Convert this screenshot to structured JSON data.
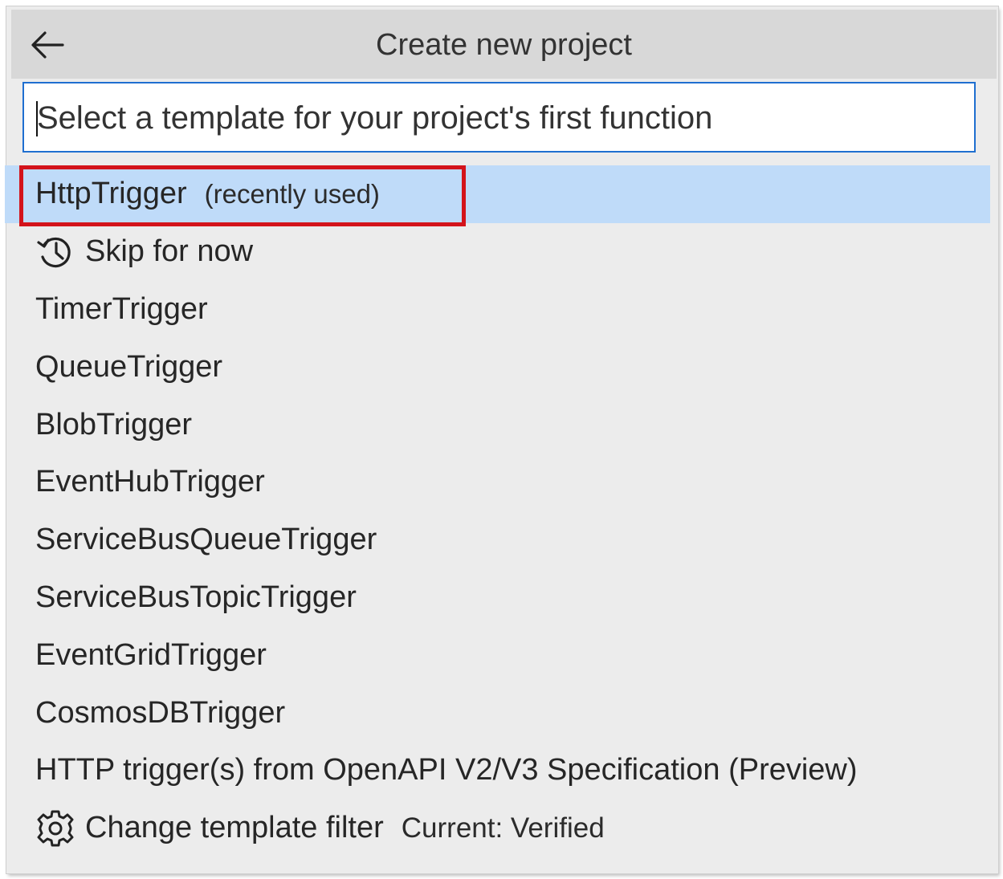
{
  "header": {
    "title": "Create new project",
    "back_icon": "arrow-left-icon"
  },
  "search": {
    "placeholder": "Select a template for your project's first function",
    "value": ""
  },
  "items": [
    {
      "label": "HttpTrigger",
      "hint": "(recently used)",
      "selected": true
    },
    {
      "label": "Skip for now",
      "icon": "history-icon"
    },
    {
      "label": "TimerTrigger"
    },
    {
      "label": "QueueTrigger"
    },
    {
      "label": "BlobTrigger"
    },
    {
      "label": "EventHubTrigger"
    },
    {
      "label": "ServiceBusQueueTrigger"
    },
    {
      "label": "ServiceBusTopicTrigger"
    },
    {
      "label": "EventGridTrigger"
    },
    {
      "label": "CosmosDBTrigger"
    },
    {
      "label": "HTTP trigger(s) from OpenAPI V2/V3 Specification (Preview)"
    },
    {
      "label": "Change template filter",
      "detail": "Current: Verified",
      "icon": "gear-icon"
    }
  ],
  "colors": {
    "selection": "#bfdbf9",
    "focus_border": "#1f6fd0",
    "highlight_box": "#d3131b",
    "panel": "#ececec",
    "header": "#d8d8d8"
  }
}
